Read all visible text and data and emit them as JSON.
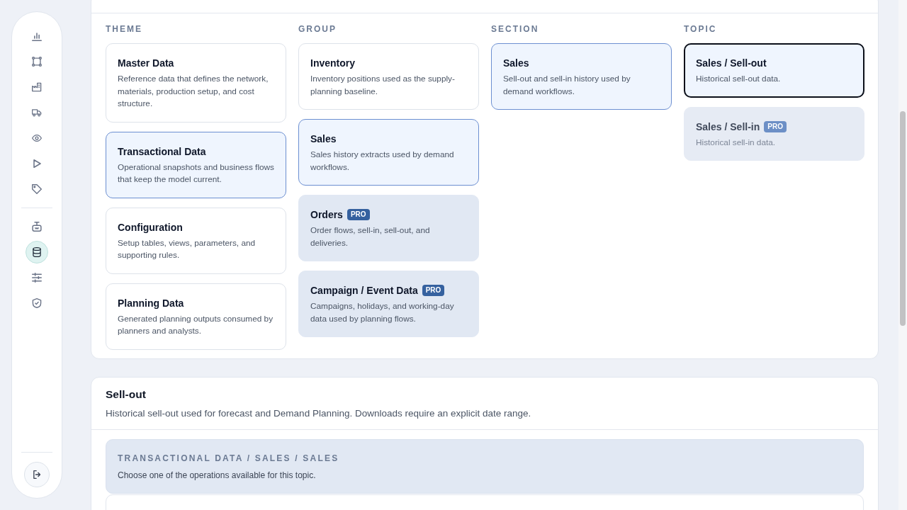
{
  "sidebar": {
    "groups": [
      {
        "items": [
          {
            "selected": false
          },
          {
            "selected": false
          },
          {
            "selected": false
          },
          {
            "selected": false
          },
          {
            "selected": false
          },
          {
            "selected": false
          },
          {
            "selected": false
          }
        ]
      },
      {
        "items": [
          {
            "selected": false
          },
          {
            "selected": true
          },
          {
            "selected": false
          },
          {
            "selected": false
          }
        ]
      }
    ]
  },
  "browser": {
    "columns": [
      {
        "heading": "THEME",
        "cards": [
          {
            "title": "Master Data",
            "description": "Reference data that defines the network, materials, production setup, and cost structure.",
            "selected": false,
            "focused": false,
            "disabled": false
          },
          {
            "title": "Transactional Data",
            "description": "Operational snapshots and business flows that keep the model current.",
            "selected": true,
            "focused": false,
            "disabled": false
          },
          {
            "title": "Configuration",
            "description": "Setup tables, views, parameters, and supporting rules.",
            "selected": false,
            "focused": false,
            "disabled": false
          },
          {
            "title": "Planning Data",
            "description": "Generated planning outputs consumed by planners and analysts.",
            "selected": false,
            "focused": false,
            "disabled": false
          }
        ]
      },
      {
        "heading": "GROUP",
        "cards": [
          {
            "title": "Inventory",
            "description": "Inventory positions used as the supply-planning baseline.",
            "selected": false,
            "focused": false,
            "disabled": false
          },
          {
            "title": "Sales",
            "description": "Sales history extracts used by demand workflows.",
            "selected": true,
            "focused": false,
            "disabled": false
          },
          {
            "title": "Orders",
            "badge": "PRO",
            "description": "Order flows, sell-in, sell-out, and deliveries.",
            "selected": false,
            "focused": false,
            "disabled": false
          },
          {
            "title": "Campaign / Event Data",
            "badge": "PRO",
            "description": "Campaigns, holidays, and working-day data used by planning flows.",
            "selected": false,
            "focused": false,
            "disabled": false
          }
        ]
      },
      {
        "heading": "SECTION",
        "cards": [
          {
            "title": "Sales",
            "description": "Sell-out and sell-in history used by demand workflows.",
            "selected": true,
            "focused": false,
            "disabled": false
          }
        ]
      },
      {
        "heading": "TOPIC",
        "cards": [
          {
            "title": "Sales / Sell-out",
            "description": "Historical sell-out data.",
            "selected": true,
            "focused": true,
            "disabled": false
          },
          {
            "title": "Sales / Sell-in",
            "badge": "PRO",
            "description": "Historical sell-in data.",
            "selected": false,
            "focused": false,
            "disabled": true
          }
        ]
      }
    ]
  },
  "detail": {
    "title": "Sell-out",
    "description": "Historical sell-out used for forecast and Demand Planning. Downloads require an explicit date range.",
    "operation": {
      "path": "TRANSACTIONAL DATA / SALES / SALES",
      "hint": "Choose one of the operations available for this topic."
    }
  }
}
